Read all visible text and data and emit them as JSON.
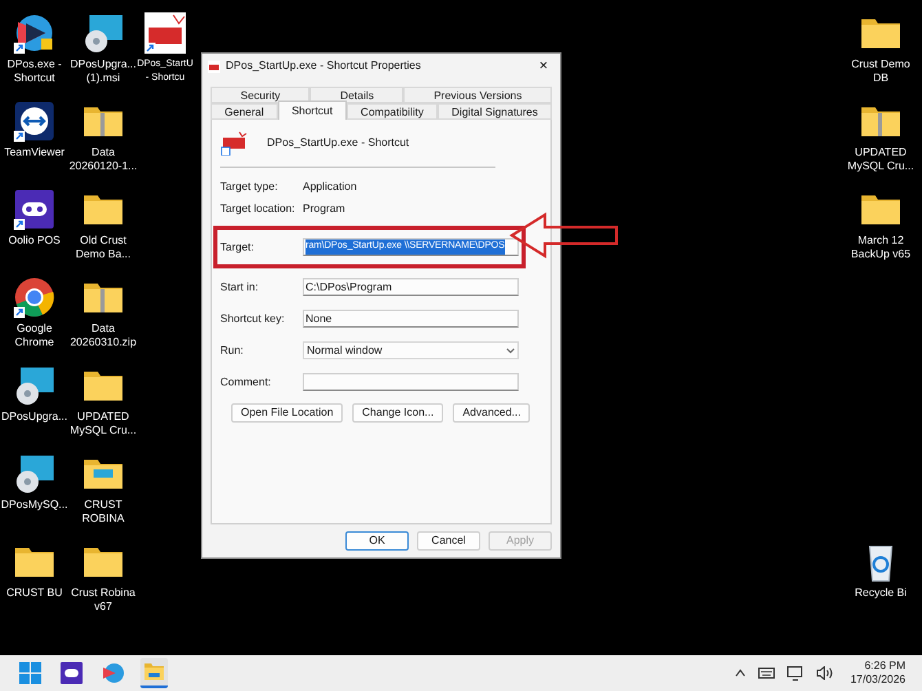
{
  "desktop": {
    "left_columns": [
      [
        {
          "kind": "app",
          "label": [
            "DPos.exe -",
            "Shortcut"
          ],
          "shortcut": true
        },
        {
          "kind": "teamviewer",
          "label": [
            "TeamViewer"
          ],
          "shortcut": true
        },
        {
          "kind": "oolio",
          "label": [
            "Oolio POS"
          ],
          "shortcut": true
        },
        {
          "kind": "chrome",
          "label": [
            "Google",
            "Chrome"
          ],
          "shortcut": true
        },
        {
          "kind": "installer",
          "label": [
            "DPosUpgra..."
          ],
          "shortcut": false
        },
        {
          "kind": "installer",
          "label": [
            "DPosMySQ..."
          ],
          "shortcut": false
        },
        {
          "kind": "folder",
          "label": [
            "CRUST BU"
          ],
          "shortcut": false
        }
      ],
      [
        {
          "kind": "installer",
          "label": [
            "DPosUpgra...",
            "(1).msi"
          ],
          "shortcut": false
        },
        {
          "kind": "zip",
          "label": [
            "Data",
            "20260120-1..."
          ],
          "shortcut": false
        },
        {
          "kind": "folder",
          "label": [
            "Old Crust",
            "Demo Ba..."
          ],
          "shortcut": false
        },
        {
          "kind": "zip",
          "label": [
            "Data",
            "20260310.zip"
          ],
          "shortcut": false
        },
        {
          "kind": "folder",
          "label": [
            "UPDATED",
            "MySQL Cru..."
          ],
          "shortcut": false
        },
        {
          "kind": "folder_doc",
          "label": [
            "CRUST",
            "ROBINA"
          ],
          "shortcut": false
        },
        {
          "kind": "folder",
          "label": [
            "Crust Robina",
            "v67"
          ],
          "shortcut": false
        }
      ],
      [
        {
          "kind": "dpos",
          "label": [
            "DPos_StartU",
            "- Shortcu"
          ],
          "shortcut": true
        }
      ]
    ],
    "right_column": [
      {
        "kind": "folder",
        "label": [
          "Crust Demo",
          "DB"
        ],
        "shortcut": false
      },
      {
        "kind": "zip",
        "label": [
          "UPDATED",
          "MySQL Cru..."
        ],
        "shortcut": false
      },
      {
        "kind": "folder",
        "label": [
          "March 12",
          "BackUp v65"
        ],
        "shortcut": false
      }
    ],
    "recycle_bin": {
      "kind": "recycle",
      "label": [
        "Recycle Bi"
      ],
      "shortcut": false
    }
  },
  "dialog": {
    "title": "DPos_StartUp.exe - Shortcut Properties",
    "close": "×",
    "tab_rows": [
      [
        {
          "label": "Security",
          "selected": false
        },
        {
          "label": "Details",
          "selected": false
        },
        {
          "label": "Previous Versions",
          "selected": false
        }
      ],
      [
        {
          "label": "General",
          "selected": false
        },
        {
          "label": "Shortcut",
          "selected": true
        },
        {
          "label": "Compatibility",
          "selected": false
        },
        {
          "label": "Digital Signatures",
          "selected": false
        }
      ]
    ],
    "shortcut_name": "DPos_StartUp.exe - Shortcut",
    "info": [
      {
        "label": "Target type:",
        "value": "Application"
      },
      {
        "label": "Target location:",
        "value": "Program"
      }
    ],
    "fields": [
      {
        "kind": "text",
        "label": "Target:",
        "value": "ram\\DPos_StartUp.exe \\\\SERVERNAME\\DPOS",
        "selected": true,
        "highlighted": true
      },
      {
        "kind": "text",
        "label": "Start in:",
        "value": "C:\\DPos\\Program",
        "selected": false,
        "highlighted": false
      },
      {
        "kind": "text",
        "label": "Shortcut key:",
        "value": "None",
        "selected": false,
        "highlighted": false
      },
      {
        "kind": "select",
        "label": "Run:",
        "value": "Normal window",
        "highlighted": false
      },
      {
        "kind": "text",
        "label": "Comment:",
        "highlighted": false
      }
    ],
    "action_buttons": [
      "Open File Location",
      "Change Icon...",
      "Advanced..."
    ],
    "footer_buttons": [
      {
        "label": "OK",
        "default": true,
        "disabled": false
      },
      {
        "label": "Cancel",
        "default": false,
        "disabled": false
      },
      {
        "label": "Apply",
        "default": false,
        "disabled": true
      }
    ]
  },
  "taskbar": {
    "apps": [
      {
        "kind": "start",
        "active": false
      },
      {
        "kind": "oolio",
        "active": false
      },
      {
        "kind": "app",
        "active": false
      },
      {
        "kind": "explorer",
        "active": true
      }
    ],
    "time": "6:26 PM",
    "date": "17/03/2026"
  }
}
